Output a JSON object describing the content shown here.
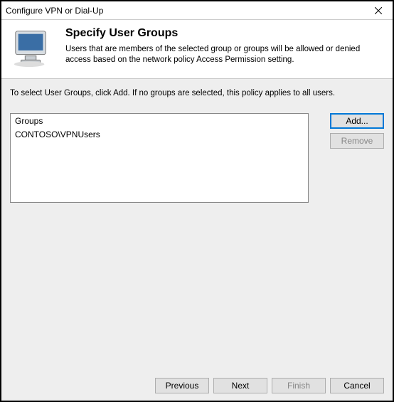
{
  "window": {
    "title": "Configure VPN or Dial-Up"
  },
  "header": {
    "heading": "Specify User Groups",
    "description": "Users that are members of the selected group or groups will be allowed or denied access based on the network policy Access Permission setting."
  },
  "content": {
    "instruction": "To select User Groups, click Add. If no groups are selected, this policy applies to all users.",
    "groups_header": "Groups",
    "groups_items": [
      "CONTOSO\\VPNUsers"
    ]
  },
  "buttons": {
    "add": "Add...",
    "remove": "Remove",
    "previous": "Previous",
    "next": "Next",
    "finish": "Finish",
    "cancel": "Cancel"
  }
}
